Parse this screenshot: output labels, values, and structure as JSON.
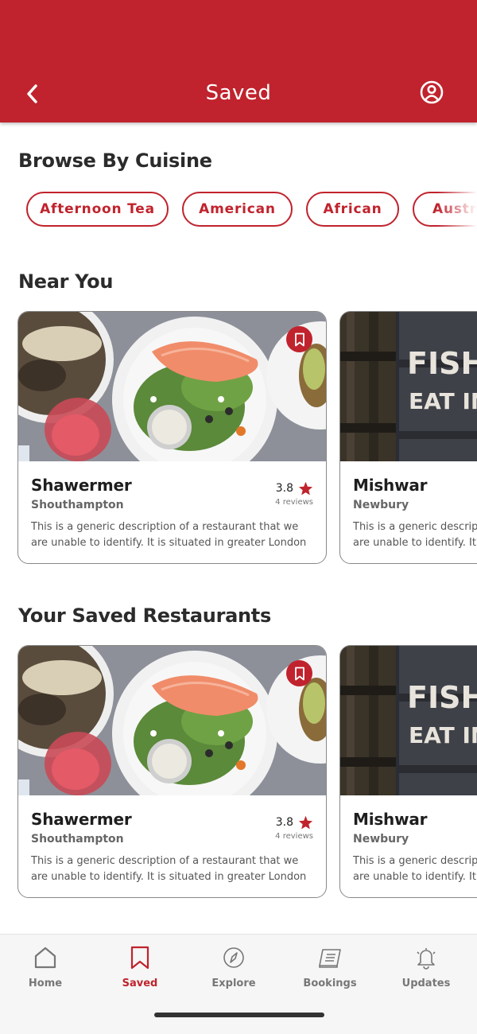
{
  "header": {
    "title": "Saved"
  },
  "cuisine": {
    "title": "Browse By Cuisine",
    "chips": [
      "Afternoon Tea",
      "American",
      "African",
      "Australian"
    ]
  },
  "near_you": {
    "title": "Near You",
    "cards": [
      {
        "name": "Shawermer",
        "city": "Shouthampton",
        "rating": "3.8",
        "reviews": "4 reviews",
        "desc_line1": "This is a generic description of a restaurant that we",
        "desc_line2": "are unable to identify. It is situated in greater London"
      },
      {
        "name": "Mishwar",
        "city": "Newbury",
        "desc_line1": "This is a generic description of a restaurant that we",
        "desc_line2": "are unable to identify. It is situated in greater London",
        "photo_sign_1": "FISH &",
        "photo_sign_2": "EAT IN OR"
      }
    ]
  },
  "saved": {
    "title": "Your Saved Restaurants",
    "cards": [
      {
        "name": "Shawermer",
        "city": "Shouthampton",
        "rating": "3.8",
        "reviews": "4 reviews",
        "desc_line1": "This is a generic description of a restaurant that we",
        "desc_line2": "are unable to identify. It is situated in greater London"
      },
      {
        "name": "Mishwar",
        "city": "Newbury",
        "desc_line1": "This is a generic description of a restaurant that we",
        "desc_line2": "are unable to identify. It is situated in greater London",
        "photo_sign_1": "FISH &",
        "photo_sign_2": "EAT IN OR"
      }
    ]
  },
  "tabs": [
    {
      "label": "Home",
      "icon": "home-icon"
    },
    {
      "label": "Saved",
      "icon": "bookmark-icon"
    },
    {
      "label": "Explore",
      "icon": "compass-icon"
    },
    {
      "label": "Bookings",
      "icon": "menu-card-icon"
    },
    {
      "label": "Updates",
      "icon": "bell-icon"
    }
  ],
  "colors": {
    "brand": "#c0232d",
    "tab_inactive": "#777777",
    "background": "#ffffff"
  }
}
